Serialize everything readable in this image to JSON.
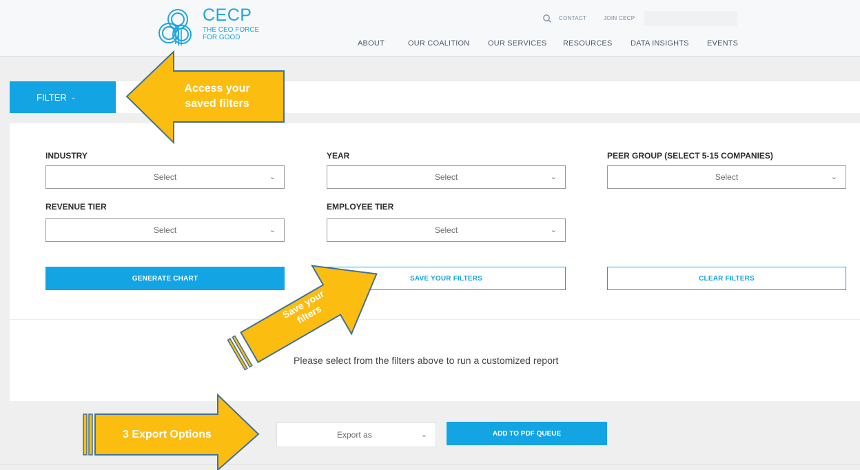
{
  "brand": {
    "name": "CECP",
    "tagline": "THE CEO FORCE FOR GOOD",
    "color": "#1fa6de"
  },
  "header": {
    "utility_links": [
      "CONTACT",
      "JOIN CECP"
    ],
    "nav": [
      "ABOUT",
      "OUR COALITION",
      "OUR SERVICES",
      "RESOURCES",
      "DATA INSIGHTS",
      "EVENTS"
    ],
    "search_icon": "search-icon"
  },
  "filter_bar": {
    "label": "FILTER",
    "chevron": "⌄"
  },
  "filters": {
    "industry": {
      "label": "INDUSTRY",
      "value": "Select"
    },
    "year": {
      "label": "YEAR",
      "value": "Select"
    },
    "peer_group": {
      "label": "PEER GROUP (SELECT 5-15 COMPANIES)",
      "value": "Select"
    },
    "revenue_tier": {
      "label": "REVENUE TIER",
      "value": "Select"
    },
    "employee_tier": {
      "label": "EMPLOYEE TIER",
      "value": "Select"
    }
  },
  "actions": {
    "generate": "GENERATE CHART",
    "save": "SAVE YOUR FILTERS",
    "clear": "CLEAR FILTERS"
  },
  "report": {
    "empty_message": "Please select from the filters above to run a customized report"
  },
  "export": {
    "select_placeholder": "Export as",
    "pdf_button": "ADD TO PDF QUEUE"
  },
  "callouts": {
    "saved_filters": [
      "Access your",
      "saved filters"
    ],
    "save_filters": [
      "Save your",
      "filters"
    ],
    "export_options": "3 Export Options",
    "fill_color": "#fbbd0f",
    "stroke_color": "#41719c"
  },
  "colors": {
    "accent": "#13a4e4",
    "page_bg": "#efefef"
  }
}
